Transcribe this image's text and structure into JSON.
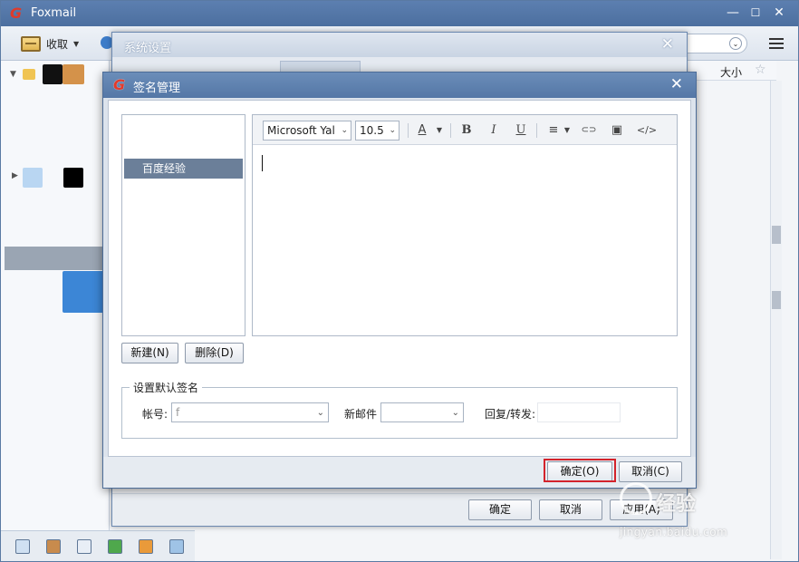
{
  "app": {
    "title": "Foxmail",
    "logo_glyph": "G",
    "accent_color": "#4c6f9f",
    "logo_color": "#e03a2a",
    "window_controls": [
      "—",
      "☐",
      "✕"
    ]
  },
  "toolbar": {
    "receive_label": "收取",
    "search_dropdown_glyph": "⌄"
  },
  "list_header": {
    "size_col": "大小",
    "star_col": "☆"
  },
  "system_settings": {
    "title": "系统设置",
    "close": "✕",
    "buttons": {
      "ok": "确定",
      "cancel": "取消",
      "apply": "应用(A)"
    }
  },
  "signature_manager": {
    "title": "签名管理",
    "close": "✕",
    "signatures": [
      {
        "label": "百度经验",
        "selected": true
      }
    ],
    "editor": {
      "font_family": "Microsoft Yal",
      "font_size": "10.5",
      "color_glyph": "A",
      "bold": "B",
      "italic": "I",
      "underline": "U",
      "align_glyph": "≡",
      "link_glyph": "⊂⊃",
      "image_glyph": "▣",
      "source_glyph": "</>"
    },
    "new_button": "新建(N)",
    "delete_button": "删除(D)",
    "default_group": {
      "legend": "设置默认签名",
      "account_label": "帐号:",
      "account_value": "f",
      "new_mail_label": "新邮件",
      "reply_label": "回复/转发:"
    },
    "ok_button": "确定(O)",
    "cancel_button": "取消(C)",
    "highlight_color": "#d3232b"
  },
  "watermark": {
    "text": "经验",
    "url": "jingyan.baidu.com"
  }
}
